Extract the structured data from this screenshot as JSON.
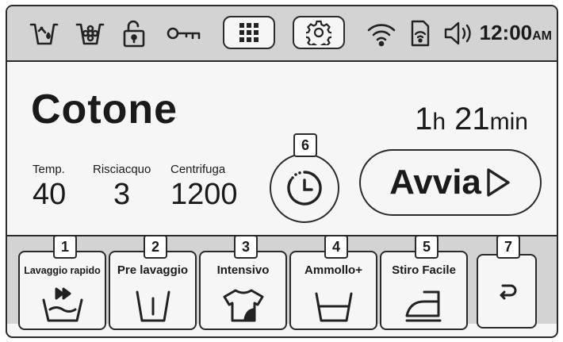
{
  "status": {
    "icons": [
      "detergent-icon",
      "fabric-softener-icon",
      "door-unlock-icon",
      "child-lock-key-icon"
    ],
    "clock": {
      "time": "12:00",
      "ampm": "AM"
    }
  },
  "program": {
    "name": "Cotone"
  },
  "duration": {
    "hours": "1",
    "hours_unit": "h",
    "minutes": "21",
    "minutes_unit": "min"
  },
  "params": [
    {
      "label": "Temp.",
      "value": "40"
    },
    {
      "label": "Risciacquo",
      "value": "3"
    },
    {
      "label": "Centrifuga",
      "value": "1200"
    }
  ],
  "timer": {
    "badge": "6"
  },
  "start": {
    "label": "Avvia"
  },
  "options": [
    {
      "badge": "1",
      "label": "Lavaggio rapido"
    },
    {
      "badge": "2",
      "label": "Pre lavaggio"
    },
    {
      "badge": "3",
      "label": "Intensivo"
    },
    {
      "badge": "4",
      "label": "Ammollo+"
    },
    {
      "badge": "5",
      "label": "Stiro Facile"
    }
  ],
  "back": {
    "badge": "7"
  }
}
